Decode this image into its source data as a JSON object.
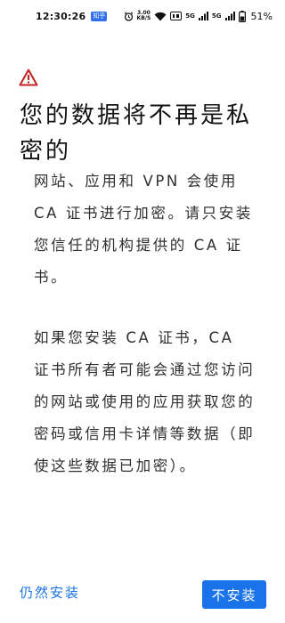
{
  "status_bar": {
    "time": "12:30:26",
    "app_badge": "知乎",
    "net_speed_value": "3.00",
    "net_speed_unit": "KB/S",
    "sim1_label": "5G",
    "sim2_label": "5G",
    "battery": "51%"
  },
  "dialog": {
    "title": "您的数据将不再是私密的",
    "paragraph_1": "网站、应用和 VPN 会使用 CA 证书进行加密。请只安装您信任的机构提供的 CA 证书。",
    "paragraph_2": "如果您安装 CA 证书，CA 证书所有者可能会通过您访问的网站或使用的应用获取您的密码或信用卡详情等数据（即使这些数据已加密）。"
  },
  "actions": {
    "install_anyway_label": "仍然安装",
    "dont_install_label": "不安装"
  },
  "colors": {
    "accent": "#1a73e8",
    "warning": "#c5221f"
  }
}
